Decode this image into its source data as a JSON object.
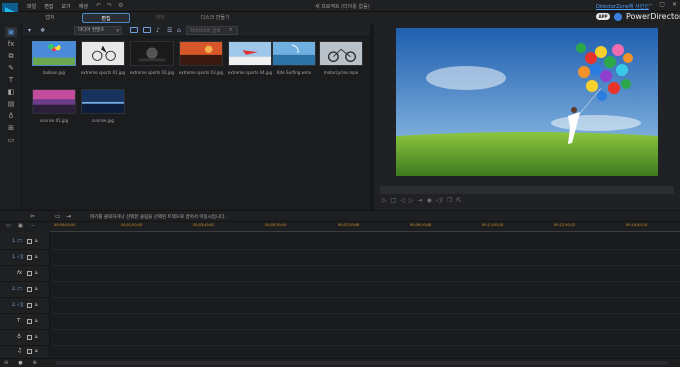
{
  "menu": [
    "파일",
    "편집",
    "보기",
    "재생"
  ],
  "quick_access": [
    "↶",
    "↷",
    "⚙"
  ],
  "document_title": "새 프로젝트 (타이틀 없음)",
  "modes": [
    {
      "label": "캡처",
      "state": "normal"
    },
    {
      "label": "편집",
      "state": "active"
    },
    {
      "label": "제작",
      "state": "disabled"
    },
    {
      "label": "디스크 만들기",
      "state": "normal"
    }
  ],
  "directorzone_link": "DirectorZone에 사인인",
  "app_badge": "APP",
  "brand": "PowerDirector",
  "library_toolbar": {
    "filter": "미디어 컨텐츠",
    "search_placeholder": "라이브러리 검색"
  },
  "media": [
    {
      "name": "balloon.jpg",
      "selected": true
    },
    {
      "name": "extreme sports 01.jpg",
      "selected": false
    },
    {
      "name": "extreme sports 02.jpg",
      "selected": false
    },
    {
      "name": "extreme sports 03.jpg",
      "selected": false
    },
    {
      "name": "extreme sports 04.jpg",
      "selected": false
    },
    {
      "name": "Kite Surfing.wmv",
      "selected": false
    },
    {
      "name": "motorcycles.mpo",
      "selected": false
    },
    {
      "name": "sunrise 01.jpg",
      "selected": false
    },
    {
      "name": "sunrise.jpg",
      "selected": false
    }
  ],
  "timeline_hint": "여기를 클릭하거나 선택한 클립을 선택된 트랙으로 끌어서 이동시킵니다.",
  "ruler_timecodes": [
    "00;00;00;00",
    "00;01;50;00",
    "00;03;40;02",
    "00;05;30;04",
    "00;07;20;06",
    "00;09;10;08",
    "00;11;00;10",
    "00;12;50;12",
    "00;14;40;14"
  ],
  "tracks": [
    {
      "num": "1.",
      "icon": "video-track-icon",
      "glyph": "▭"
    },
    {
      "num": "1.",
      "icon": "audio-track-icon",
      "glyph": "◁)"
    },
    {
      "num": "",
      "icon": "fx-track-icon",
      "glyph": "fx"
    },
    {
      "num": "2.",
      "icon": "video-track-icon",
      "glyph": "▭"
    },
    {
      "num": "2.",
      "icon": "audio-track-icon",
      "glyph": "◁)"
    },
    {
      "num": "",
      "icon": "title-track-icon",
      "glyph": "T"
    },
    {
      "num": "",
      "icon": "voice-track-icon",
      "glyph": "♁"
    },
    {
      "num": "",
      "icon": "music-track-icon",
      "glyph": "♫"
    }
  ],
  "colors": {
    "accent": "#4d88c9",
    "timecode": "#d89a2b",
    "link": "#4ea0ff"
  }
}
